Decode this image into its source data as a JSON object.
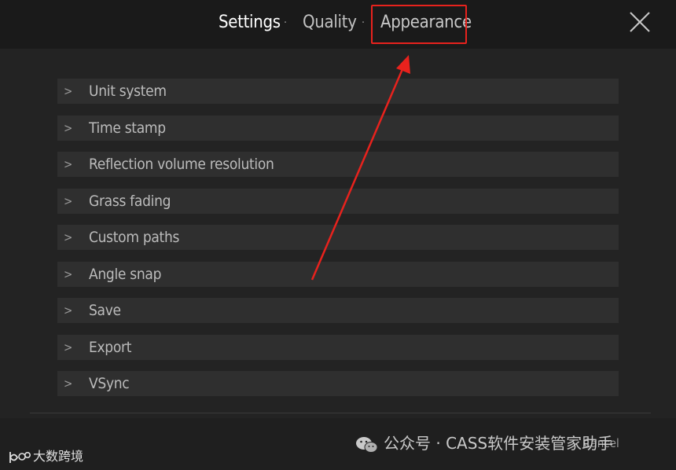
{
  "header": {
    "tabs": [
      {
        "label": "Settings",
        "active": true
      },
      {
        "label": "Quality",
        "active": false
      },
      {
        "label": "Appearance",
        "active": false,
        "highlighted": true
      }
    ],
    "separator": "·",
    "close_icon": "close-icon"
  },
  "menu": {
    "chevron": ">",
    "items": [
      {
        "label": "Unit system"
      },
      {
        "label": "Time stamp"
      },
      {
        "label": "Reflection volume resolution"
      },
      {
        "label": "Grass fading"
      },
      {
        "label": "Custom paths"
      },
      {
        "label": "Angle snap"
      },
      {
        "label": "Save"
      },
      {
        "label": "Export"
      },
      {
        "label": "VSync"
      }
    ]
  },
  "footer": {
    "button_label": "Cancel"
  },
  "watermark": {
    "wechat_text": "公众号 · CASS软件安装管家助手",
    "logo_text": "大数跨境"
  },
  "colors": {
    "background": "#232323",
    "header": "#1a1a1a",
    "item": "#2f2f2f",
    "highlight": "#e8221d",
    "text": "#bcbcbc"
  }
}
